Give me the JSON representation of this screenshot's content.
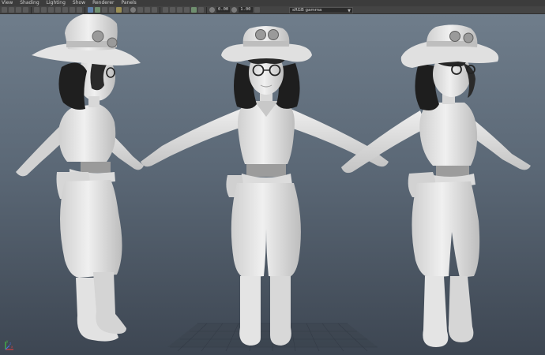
{
  "menu": [
    "View",
    "Shading",
    "Lighting",
    "Show",
    "Renderer",
    "Panels"
  ],
  "toolbar": {
    "near_value": "0.00",
    "gamma_value": "1.00",
    "color_space": "sRGB gamma"
  },
  "viewport": {
    "background_top": "#6f7d8b",
    "background_bottom": "#3d4652",
    "model_color": "#e6e6e6",
    "hair_color": "#222222",
    "views": [
      "side-view-character",
      "front-view-character",
      "three-quarter-view-character"
    ]
  },
  "axis": {
    "x": "x",
    "y": "y",
    "z": "z"
  }
}
